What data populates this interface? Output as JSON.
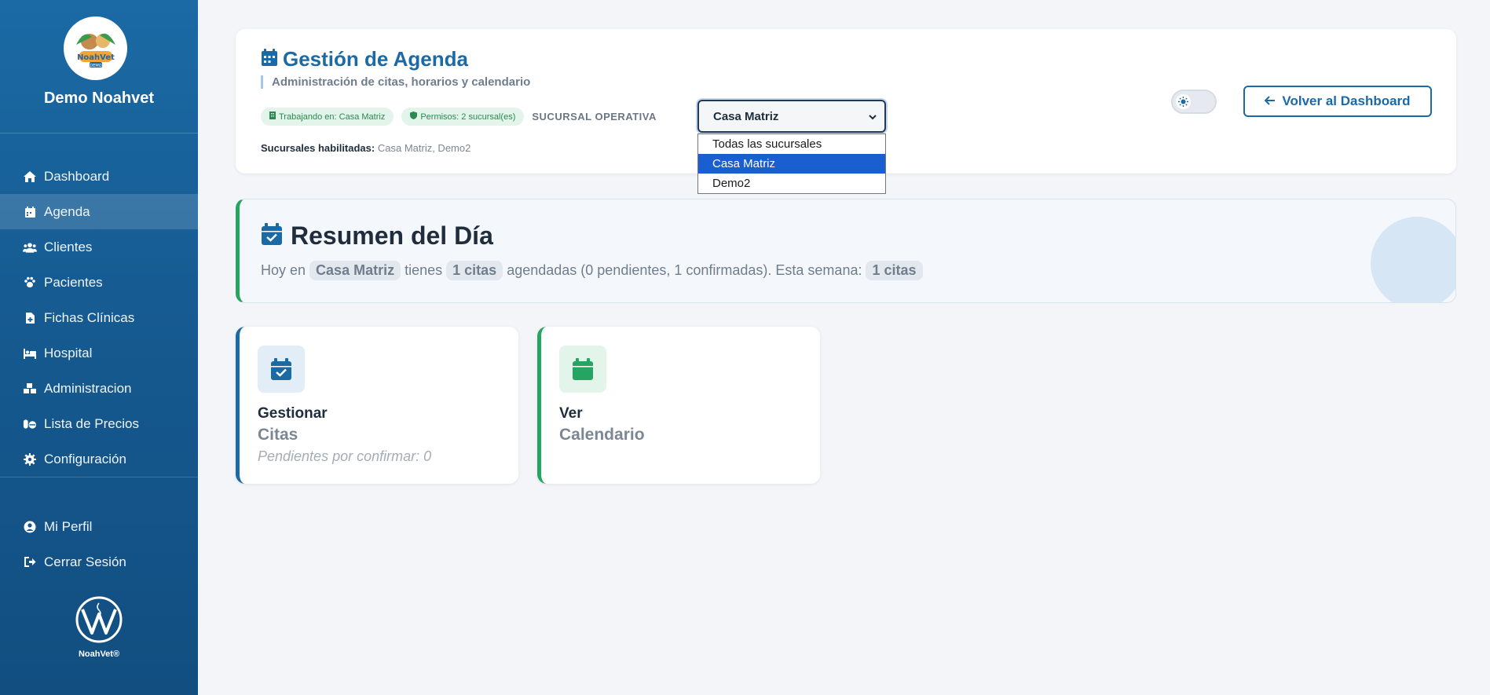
{
  "sidebar": {
    "brand_name": "Demo Noahvet",
    "logo_text": "NoahVet",
    "logo_sub": "DEMO",
    "items": [
      {
        "label": "Dashboard",
        "icon": "home-icon"
      },
      {
        "label": "Agenda",
        "icon": "calendar-icon",
        "active": true
      },
      {
        "label": "Clientes",
        "icon": "users-icon"
      },
      {
        "label": "Pacientes",
        "icon": "paw-icon"
      },
      {
        "label": "Fichas Clínicas",
        "icon": "file-medical-icon"
      },
      {
        "label": "Hospital",
        "icon": "hospital-bed-icon"
      },
      {
        "label": "Administracion",
        "icon": "boxes-icon"
      },
      {
        "label": "Lista de Precios",
        "icon": "pills-icon"
      },
      {
        "label": "Configuración",
        "icon": "gear-icon"
      }
    ],
    "secondary": [
      {
        "label": "Mi Perfil",
        "icon": "user-circle-icon"
      },
      {
        "label": "Cerrar Sesión",
        "icon": "sign-out-icon"
      }
    ],
    "footer_text": "NoahVet®"
  },
  "header": {
    "title": "Gestión de Agenda",
    "subtitle": "Administración de citas, horarios y calendario",
    "badge_working": "Trabajando en: Casa Matriz",
    "badge_permissions": "Permisos: 2 sucursal(es)",
    "sucursal_label": "SUCURSAL OPERATIVA",
    "select_value": "Casa Matriz",
    "select_options": [
      "Todas las sucursales",
      "Casa Matriz",
      "Demo2"
    ],
    "enabled_label": "Sucursales habilitadas:",
    "enabled_value": "Casa Matriz, Demo2",
    "back_button": "Volver al Dashboard"
  },
  "summary": {
    "title": "Resumen del Día",
    "text_hoy": "Hoy en",
    "branch": "Casa Matriz",
    "text_tienes": "tienes",
    "count_today": "1 citas",
    "text_detail": "agendadas (0 pendientes, 1 confirmadas). Esta semana:",
    "count_week": "1 citas"
  },
  "actions": [
    {
      "title": "Gestionar",
      "subtitle": "Citas",
      "note": "Pendientes por confirmar: 0"
    },
    {
      "title": "Ver",
      "subtitle": "Calendario"
    }
  ],
  "colors": {
    "primary": "#1b6aa5",
    "success": "#26a461",
    "sidebar": "#15598f"
  }
}
